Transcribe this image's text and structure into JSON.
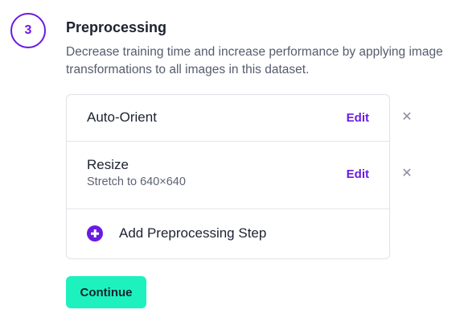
{
  "step": {
    "number": "3",
    "title": "Preprocessing",
    "description": "Decrease training time and increase performance by applying image transformations to all images in this dataset."
  },
  "steps_list": [
    {
      "title": "Auto-Orient",
      "subtitle": "",
      "edit_label": "Edit",
      "remove_icon": "✕"
    },
    {
      "title": "Resize",
      "subtitle": "Stretch to 640×640",
      "edit_label": "Edit",
      "remove_icon": "✕"
    }
  ],
  "add_step": {
    "label": "Add Preprocessing Step",
    "icon": "plus-circle-icon"
  },
  "continue_label": "Continue",
  "colors": {
    "accent": "#6a1be0",
    "continue_bg": "#1df2bf",
    "muted_text": "#555c6e",
    "border": "#dfe2e8"
  }
}
